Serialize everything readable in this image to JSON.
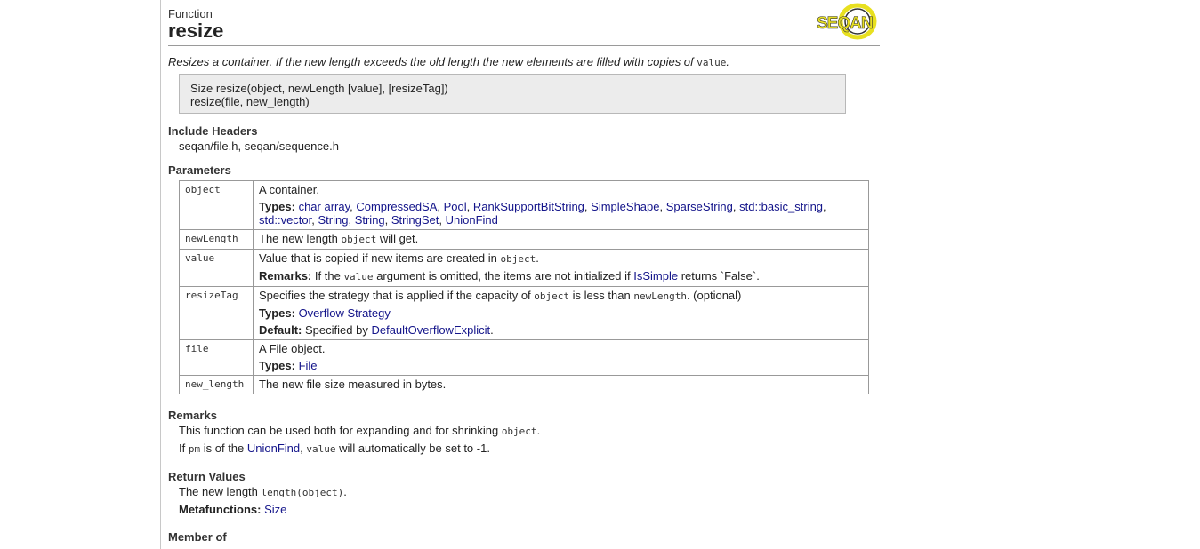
{
  "header": {
    "kind": "Function",
    "title": "resize",
    "logo_text": "SEQAN"
  },
  "summary": {
    "text": "Resizes a container. If the new length exceeds the old length the new elements are filled with copies of",
    "code": "value",
    "end": "."
  },
  "signature": {
    "lines": [
      "Size resize(object, newLength [value], [resizeTag])",
      "resize(file, new_length)"
    ]
  },
  "include_headers": {
    "heading": "Include Headers",
    "value": "seqan/file.h, seqan/sequence.h"
  },
  "parameters": {
    "heading": "Parameters",
    "types_label": "Types:",
    "remarks_label": "Remarks:",
    "default_label": "Default:",
    "object": {
      "name": "object",
      "desc": "A container.",
      "types": [
        "char array",
        "CompressedSA",
        "Pool",
        "RankSupportBitString",
        "SimpleShape",
        "SparseString",
        "std::basic_string",
        "std::vector",
        "String",
        "String",
        "StringSet",
        "UnionFind"
      ]
    },
    "newLength": {
      "name": "newLength",
      "desc_a": "The new length",
      "desc_code": "object",
      "desc_b": "will get."
    },
    "value": {
      "name": "value",
      "desc_a": "Value that is copied if new items are created in",
      "desc_code": "object",
      "desc_b": ".",
      "rem_a": "If the",
      "rem_code": "value",
      "rem_b": "argument is omitted, the items are not initialized if",
      "rem_link": "IsSimple",
      "rem_c": "returns `False`."
    },
    "resizeTag": {
      "name": "resizeTag",
      "desc_a": "Specifies the strategy that is applied if the capacity of",
      "desc_code1": "object",
      "desc_b": "is less than",
      "desc_code2": "newLength",
      "desc_c": ". (optional)",
      "types_link": "Overflow Strategy",
      "default_a": "Specified by",
      "default_link": "DefaultOverflowExplicit",
      "default_b": "."
    },
    "file": {
      "name": "file",
      "desc": "A File object.",
      "types_link": "File"
    },
    "new_length": {
      "name": "new_length",
      "desc": "The new file size measured in bytes."
    }
  },
  "remarks": {
    "heading": "Remarks",
    "line1_a": "This function can be used both for expanding and for shrinking",
    "line1_code": "object",
    "line1_b": ".",
    "line2_a": "If",
    "line2_code1": "pm",
    "line2_b": "is of the",
    "line2_link": "UnionFind",
    "line2_c": ",",
    "line2_code2": "value",
    "line2_d": "will automatically be set to -1."
  },
  "return_values": {
    "heading": "Return Values",
    "line_a": "The new length",
    "line_code": "length(object)",
    "line_b": ".",
    "meta_label": "Metafunctions:",
    "meta_link": "Size"
  },
  "member_of": {
    "heading": "Member of"
  },
  "colors": {
    "link": "#13148a",
    "signature_bg": "#ececec",
    "logo_yellow": "#e8e020"
  }
}
